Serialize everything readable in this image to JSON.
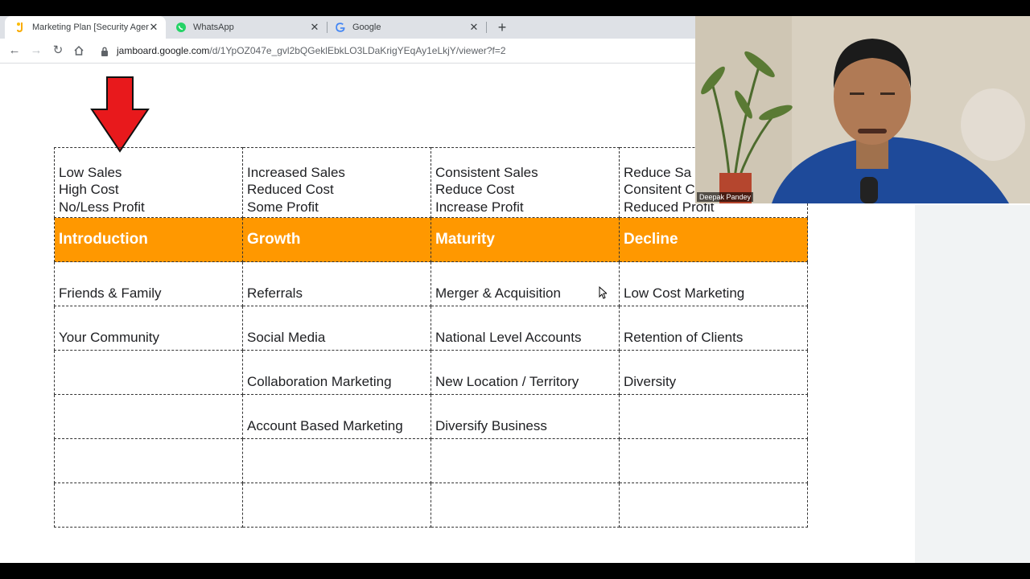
{
  "browser": {
    "tabs": [
      {
        "title": "Marketing Plan [Security Agency",
        "active": true
      },
      {
        "title": "WhatsApp",
        "active": false
      },
      {
        "title": "Google",
        "active": false
      }
    ],
    "url_domain": "jamboard.google.com",
    "url_path": "/d/1YpOZ047e_gvl2bQGeklEbkLO3LDaKrigYEqAy1eLkjY/viewer?f=2"
  },
  "board": {
    "header_rows": [
      [
        "Low Sales",
        "Increased Sales",
        "Consistent Sales",
        "Reduce Sa"
      ],
      [
        "High Cost",
        "Reduced Cost",
        "Reduce Cost",
        "Consitent C"
      ],
      [
        "No/Less Profit",
        "Some Profit",
        "Increase Profit",
        "Reduced Profit"
      ]
    ],
    "stages": [
      "Introduction",
      "Growth",
      "Maturity",
      "Decline"
    ],
    "items": [
      [
        "Friends & Family",
        "Referrals",
        "Merger & Acquisition",
        "Low Cost Marketing"
      ],
      [
        "Your Community",
        "Social Media",
        "National Level Accounts",
        "Retention of Clients"
      ],
      [
        "",
        "Collaboration Marketing",
        "New Location / Territory",
        "Diversity"
      ],
      [
        "",
        "Account Based Marketing",
        "Diversify Business",
        ""
      ],
      [
        "",
        "",
        "",
        ""
      ],
      [
        "",
        "",
        "",
        ""
      ]
    ]
  },
  "webcam": {
    "name": "Deepak Pandey"
  },
  "colors": {
    "stage_fill": "#ff9800",
    "arrow": "#e8191c"
  }
}
